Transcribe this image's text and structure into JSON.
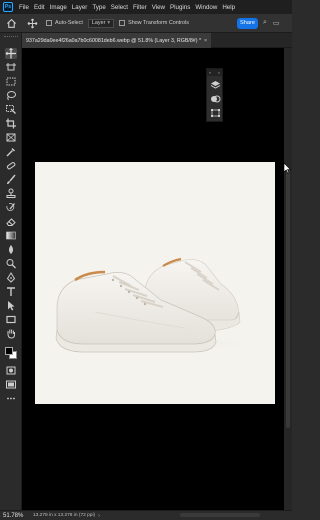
{
  "app": {
    "logo_text": "Ps"
  },
  "menu": [
    "File",
    "Edit",
    "Image",
    "Layer",
    "Type",
    "Select",
    "Filter",
    "View",
    "Plugins",
    "Window",
    "Help"
  ],
  "options": {
    "auto_select_label": "Auto-Select",
    "auto_select_target": "Layer",
    "show_transform_label": "Show Transform Controls",
    "share_label": "Share"
  },
  "document": {
    "tab_title": "937a29da0ee4f26a0a7b0c60081deb6.webp @ 51.8% (Layer 3, RGB/8#) *",
    "close_glyph": "×"
  },
  "float_panel": {
    "collapse": "»",
    "close": "×"
  },
  "status": {
    "zoom": "51.78%",
    "info": "13.278 in x 13.278 in (72 ppi)",
    "arrow": "›"
  },
  "colors": {
    "accent": "#1473e6",
    "menubar_bg": "#1f1f1f",
    "panel_bg": "#2b2b2b",
    "canvas_bg": "#f5f3ee",
    "workspace_bg": "#000000"
  },
  "icons": {
    "toolbar": [
      "move-icon",
      "artboard-icon",
      "marquee-icon",
      "lasso-icon",
      "object-select-icon",
      "crop-icon",
      "frame-icon",
      "eyedropper-icon",
      "spot-heal-icon",
      "brush-icon",
      "clone-stamp-icon",
      "history-brush-icon",
      "eraser-icon",
      "gradient-icon",
      "blur-icon",
      "dodge-icon",
      "pen-icon",
      "type-icon",
      "path-select-icon",
      "rectangle-icon",
      "hand-icon",
      "zoom-icon",
      "edit-toolbar-icon"
    ]
  }
}
